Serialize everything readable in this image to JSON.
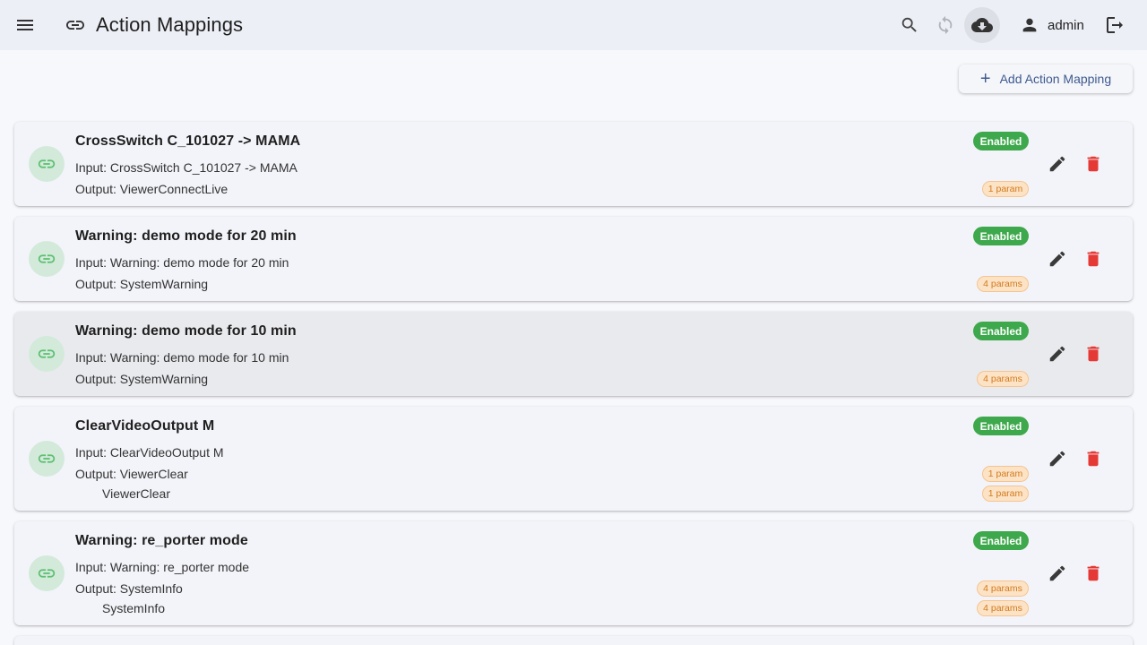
{
  "header": {
    "title": "Action Mappings",
    "username": "admin",
    "icons": {
      "menu": "menu-icon",
      "title": "link-icon",
      "search": "search-icon",
      "sync": "sync-icon",
      "download": "cloud-download-icon",
      "user": "person-icon",
      "logout": "logout-icon"
    }
  },
  "toolbar": {
    "add_label": "Add Action Mapping"
  },
  "colors": {
    "enabled_badge": "#3ea84c",
    "param_badge_bg": "#fde3c6",
    "param_badge_text": "#d27a1c",
    "delete_icon": "#e53935",
    "link_icon": "#5cbf6f"
  },
  "mappings": [
    {
      "title": "CrossSwitch C_101027 -> MAMA",
      "input": "Input: CrossSwitch C_101027 -> MAMA",
      "output": "Output: ViewerConnectLive",
      "extra_outputs": [],
      "status": "Enabled",
      "params": [
        "1 param"
      ]
    },
    {
      "title": "Warning: demo mode for 20 min",
      "input": "Input: Warning: demo mode for 20 min",
      "output": "Output: SystemWarning",
      "extra_outputs": [],
      "status": "Enabled",
      "params": [
        "4 params"
      ]
    },
    {
      "title": "Warning: demo mode for 10 min",
      "input": "Input: Warning: demo mode for 10 min",
      "output": "Output: SystemWarning",
      "extra_outputs": [],
      "status": "Enabled",
      "params": [
        "4 params"
      ]
    },
    {
      "title": "ClearVideoOutput M",
      "input": "Input: ClearVideoOutput M",
      "output": "Output: ViewerClear",
      "extra_outputs": [
        "ViewerClear"
      ],
      "status": "Enabled",
      "params": [
        "1 param",
        "1 param"
      ]
    },
    {
      "title": "Warning: re_porter mode",
      "input": "Input: Warning: re_porter mode",
      "output": "Output: SystemInfo",
      "extra_outputs": [
        "SystemInfo"
      ],
      "status": "Enabled",
      "params": [
        "4 params",
        "4 params"
      ]
    }
  ]
}
